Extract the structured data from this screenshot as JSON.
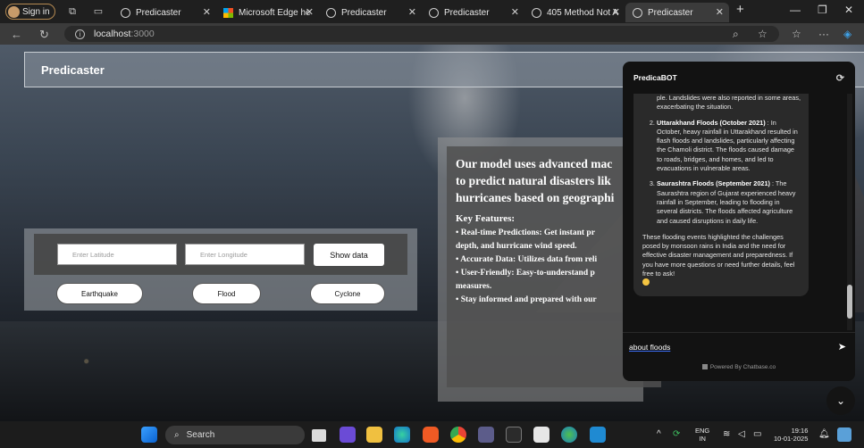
{
  "browser": {
    "signin_label": "Sign in",
    "tabs": [
      {
        "title": "Predicaster"
      },
      {
        "title": "Microsoft Edge he"
      },
      {
        "title": "Predicaster"
      },
      {
        "title": "Predicaster"
      },
      {
        "title": "405 Method Not A"
      },
      {
        "title": "Predicaster"
      }
    ],
    "url_host": "localhost",
    "url_port": ":3000"
  },
  "page": {
    "brand": "Predicaster",
    "latitude_placeholder": "Enter Latitude",
    "longitude_placeholder": "Enter Longitude",
    "show_data_label": "Show data",
    "buttons": [
      "Earthquake",
      "Flood",
      "Cyclone"
    ],
    "intro_lines": [
      "Our model uses advanced mac",
      "to predict natural disasters lik",
      "hurricanes based on geographi"
    ],
    "features_title": "Key Features:",
    "features": [
      "Real-time Predictions: Get instant pr",
      "depth, and hurricane wind speed.",
      "Accurate Data: Utilizes data from reli",
      "User-Friendly: Easy-to-understand p",
      "measures.",
      "Stay informed and prepared with our"
    ]
  },
  "chat": {
    "title": "PredicaBOT",
    "top_fragment": "ple. Landslides were also reported in some areas, exacerbating the situation.",
    "items": [
      {
        "heading": "Uttarakhand Floods (October 2021)",
        "sep": " : ",
        "body": "In October, heavy rainfall in Uttarakhand resulted in flash floods and landslides, particularly affecting the Chamoli district. The floods caused damage to roads, bridges, and homes, and led to evacuations in vulnerable areas."
      },
      {
        "heading": "Saurashtra Floods (September 2021)",
        "sep": " : ",
        "body": "The Saurashtra region of Gujarat experienced heavy rainfall in September, leading to flooding in several districts. The floods affected agriculture and caused disruptions in daily life."
      }
    ],
    "closing": "These flooding events highlighted the challenges posed by monsoon rains in India and the need for effective disaster management and preparedness. If you have more questions or need further details, feel free to ask!",
    "input_value": "about floods",
    "powered_by": "Powered By Chatbase.co"
  },
  "taskbar": {
    "search_label": "Search",
    "lang_line1": "ENG",
    "lang_line2": "IN",
    "time": "19:16",
    "date": "10-01-2025"
  }
}
